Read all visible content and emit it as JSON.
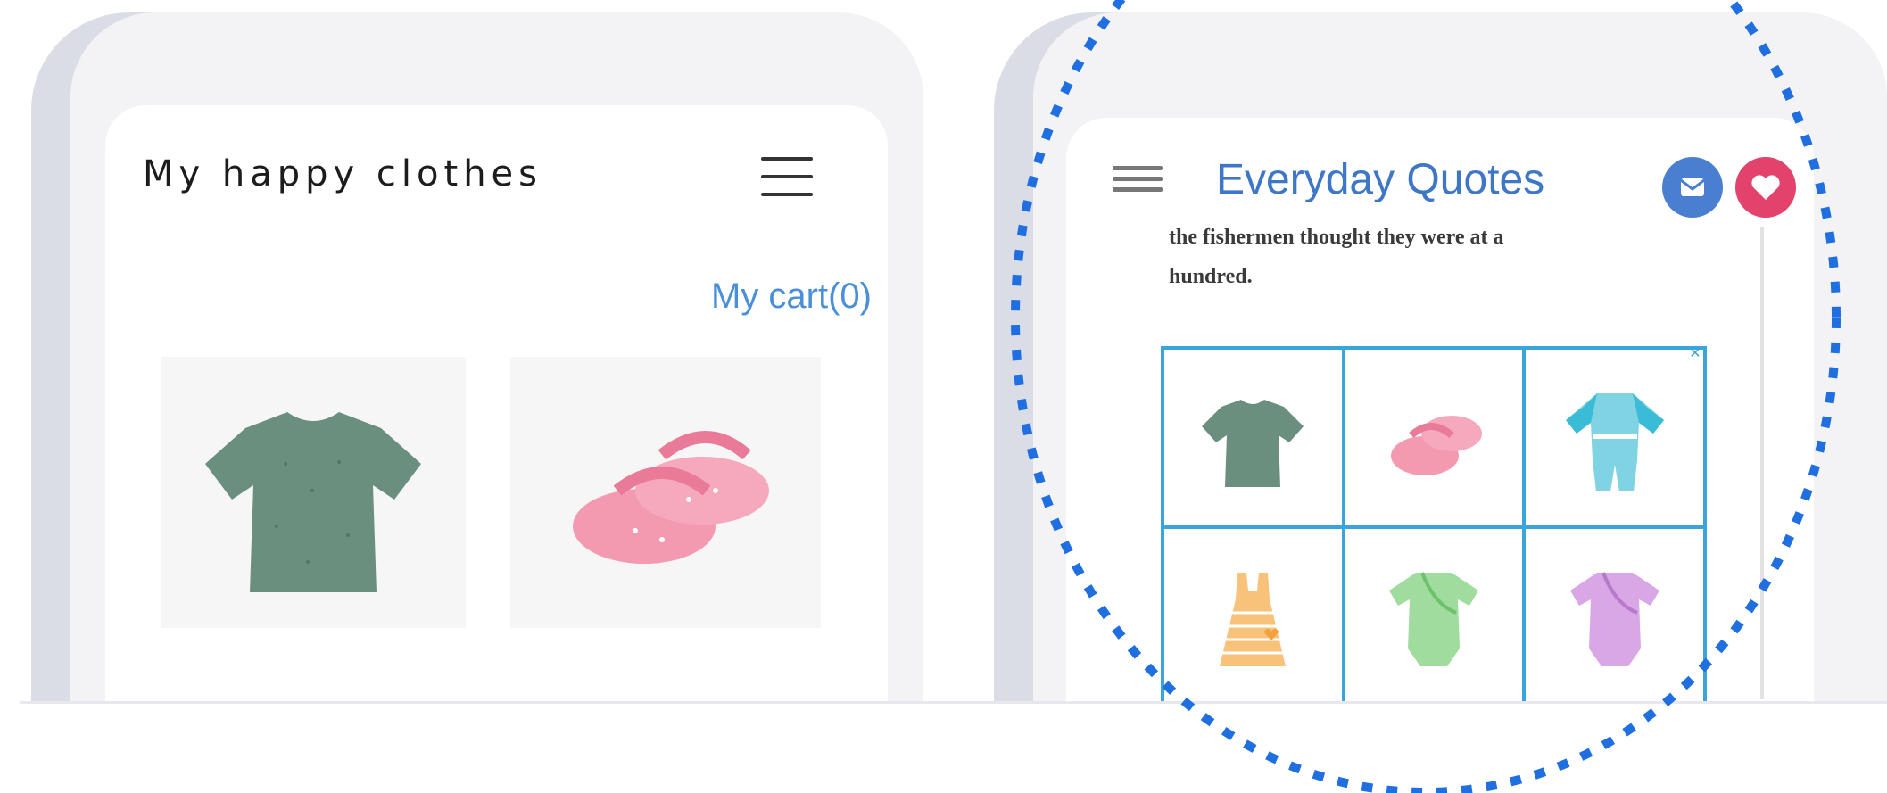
{
  "left_phone": {
    "title": "My happy clothes",
    "cart_label": "My cart(0)",
    "products": [
      {
        "name": "green-tshirt",
        "color": "#6b8f7e"
      },
      {
        "name": "pink-shoes",
        "color": "#f39ab0"
      }
    ]
  },
  "right_phone": {
    "title": "Everyday Quotes",
    "quote_lines": [
      "the fishermen thought they were at a",
      "hundred."
    ],
    "ad_grid": [
      {
        "name": "green-tshirt",
        "color": "#6b8f7e"
      },
      {
        "name": "pink-shoes",
        "color": "#f39ab0"
      },
      {
        "name": "blue-sleepsuit",
        "color": "#7fd3e3"
      },
      {
        "name": "striped-dress",
        "color": "#f8c27a"
      },
      {
        "name": "green-bodysuit",
        "color": "#9fdc9d"
      },
      {
        "name": "purple-bodysuit",
        "color": "#d9a6e6"
      }
    ],
    "message_button_color": "#4a7fd0",
    "heart_button_color": "#e2426b"
  },
  "highlight": {
    "color": "#1f6fe0",
    "style": "dotted-circle"
  }
}
